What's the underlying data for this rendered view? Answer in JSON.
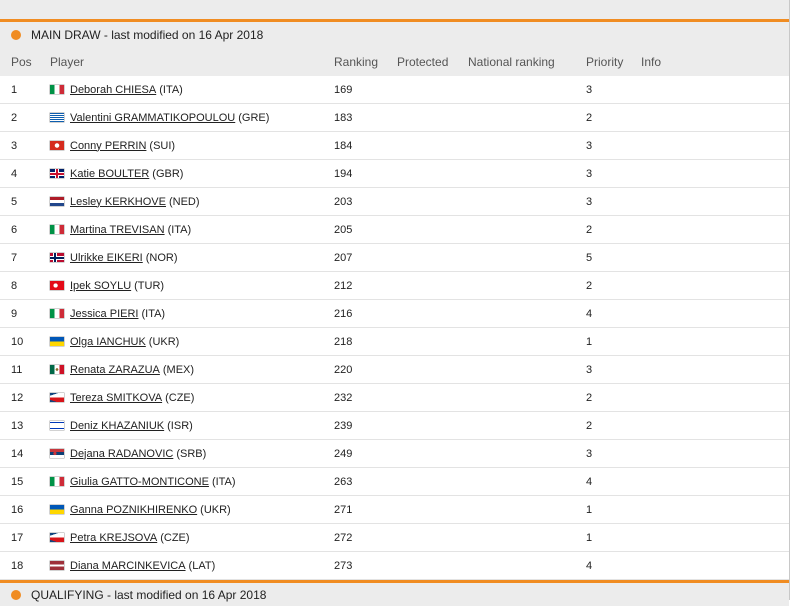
{
  "main_header": "MAIN DRAW - last modified on 16 Apr 2018",
  "columns": {
    "pos": "Pos",
    "player": "Player",
    "ranking": "Ranking",
    "protected": "Protected",
    "national_ranking": "National ranking",
    "priority": "Priority",
    "info": "Info"
  },
  "rows": [
    {
      "pos": "1",
      "name": "Deborah CHIESA",
      "nat": "(ITA)",
      "ranking": "169",
      "priority": "3",
      "flag": "ita"
    },
    {
      "pos": "2",
      "name": "Valentini GRAMMATIKOPOULOU",
      "nat": "(GRE)",
      "ranking": "183",
      "priority": "2",
      "flag": "gre"
    },
    {
      "pos": "3",
      "name": "Conny PERRIN",
      "nat": "(SUI)",
      "ranking": "184",
      "priority": "3",
      "flag": "sui"
    },
    {
      "pos": "4",
      "name": "Katie BOULTER",
      "nat": "(GBR)",
      "ranking": "194",
      "priority": "3",
      "flag": "gbr"
    },
    {
      "pos": "5",
      "name": "Lesley KERKHOVE",
      "nat": "(NED)",
      "ranking": "203",
      "priority": "3",
      "flag": "ned"
    },
    {
      "pos": "6",
      "name": "Martina TREVISAN",
      "nat": "(ITA)",
      "ranking": "205",
      "priority": "2",
      "flag": "ita"
    },
    {
      "pos": "7",
      "name": "Ulrikke EIKERI",
      "nat": "(NOR)",
      "ranking": "207",
      "priority": "5",
      "flag": "nor"
    },
    {
      "pos": "8",
      "name": "Ipek SOYLU",
      "nat": "(TUR)",
      "ranking": "212",
      "priority": "2",
      "flag": "tur"
    },
    {
      "pos": "9",
      "name": "Jessica PIERI",
      "nat": "(ITA)",
      "ranking": "216",
      "priority": "4",
      "flag": "ita"
    },
    {
      "pos": "10",
      "name": "Olga IANCHUK",
      "nat": "(UKR)",
      "ranking": "218",
      "priority": "1",
      "flag": "ukr"
    },
    {
      "pos": "11",
      "name": "Renata ZARAZUA",
      "nat": "(MEX)",
      "ranking": "220",
      "priority": "3",
      "flag": "mex"
    },
    {
      "pos": "12",
      "name": "Tereza SMITKOVA",
      "nat": "(CZE)",
      "ranking": "232",
      "priority": "2",
      "flag": "cze"
    },
    {
      "pos": "13",
      "name": "Deniz KHAZANIUK",
      "nat": "(ISR)",
      "ranking": "239",
      "priority": "2",
      "flag": "isr"
    },
    {
      "pos": "14",
      "name": "Dejana RADANOVIC",
      "nat": "(SRB)",
      "ranking": "249",
      "priority": "3",
      "flag": "srb"
    },
    {
      "pos": "15",
      "name": "Giulia GATTO-MONTICONE",
      "nat": "(ITA)",
      "ranking": "263",
      "priority": "4",
      "flag": "ita"
    },
    {
      "pos": "16",
      "name": "Ganna POZNIKHIRENKO",
      "nat": "(UKR)",
      "ranking": "271",
      "priority": "1",
      "flag": "ukr"
    },
    {
      "pos": "17",
      "name": "Petra KREJSOVA",
      "nat": "(CZE)",
      "ranking": "272",
      "priority": "1",
      "flag": "cze"
    },
    {
      "pos": "18",
      "name": "Diana MARCINKEVICA",
      "nat": "(LAT)",
      "ranking": "273",
      "priority": "4",
      "flag": "lat"
    }
  ],
  "qualifying_header": "QUALIFYING - last modified on 16 Apr 2018",
  "colors": {
    "accent": "#f08c22",
    "panel_bg": "#ececec",
    "row_bg": "#ffffff"
  },
  "flag_styles": {
    "ita": "linear-gradient(to right,#009246 0 33.3%,#ffffff 33.3% 66.6%,#ce2b37 66.6%)",
    "gre": "repeating-linear-gradient(to bottom,#0d5eaf 0 1px,#ffffff 1px 2px)",
    "sui": "radial-gradient(circle,#ffffff 0 2px,#d52b1e 2.5px)",
    "gbr": "linear-gradient(#c8102e,#c8102e) center/14px 2px no-repeat, linear-gradient(#c8102e,#c8102e) center/2px 9px no-repeat, linear-gradient(#ffffff,#ffffff) center/14px 4px no-repeat, linear-gradient(#ffffff,#ffffff) center/4px 9px no-repeat, #012169",
    "ned": "linear-gradient(to bottom,#ae1c28 0 33.3%,#ffffff 33.3% 66.6%,#21468b 66.6%)",
    "nor": "linear-gradient(#00205b,#00205b) 4px 0/2px 9px no-repeat, linear-gradient(#00205b,#00205b) 0 3.5px/14px 2px no-repeat, linear-gradient(#ffffff,#ffffff) 3px 0/4px 9px no-repeat, linear-gradient(#ffffff,#ffffff) 0 2.5px/14px 4px no-repeat, #ba0c2f",
    "tur": "radial-gradient(circle at 40% 50%,#ffffff 0 2px,transparent 2.3px), #e30a17",
    "ukr": "linear-gradient(to bottom,#0057b7 0 50%,#ffd700 50%)",
    "mex": "radial-gradient(circle,#8c6d2c 0 1.2px,transparent 1.5px), linear-gradient(to right,#006847 0 33.3%,#ffffff 33.3% 66.6%,#ce1126 66.6%)",
    "cze": "linear-gradient(to bottom right,#11457e 0 30%,transparent 30%) 0 0/14px 4.5px no-repeat, linear-gradient(to top right,#11457e 0 30%,transparent 30%) 0 4.5px/14px 4.5px no-repeat, linear-gradient(to bottom,#ffffff 0 50%,#d7141a 50%)",
    "isr": "linear-gradient(to bottom,#ffffff 0 12%,#0038b8 12% 24%,#ffffff 24% 76%,#0038b8 76% 88%,#ffffff 88%)",
    "srb": "radial-gradient(circle at 35% 50%,#c6363c 0 1.5px,transparent 1.8px), linear-gradient(to bottom,#c6363c 0 33.3%,#0c4076 33.3% 66.6%,#ffffff 66.6%)",
    "lat": "linear-gradient(to bottom,#9e3039 0 40%,#ffffff 40% 60%,#9e3039 60%)"
  }
}
